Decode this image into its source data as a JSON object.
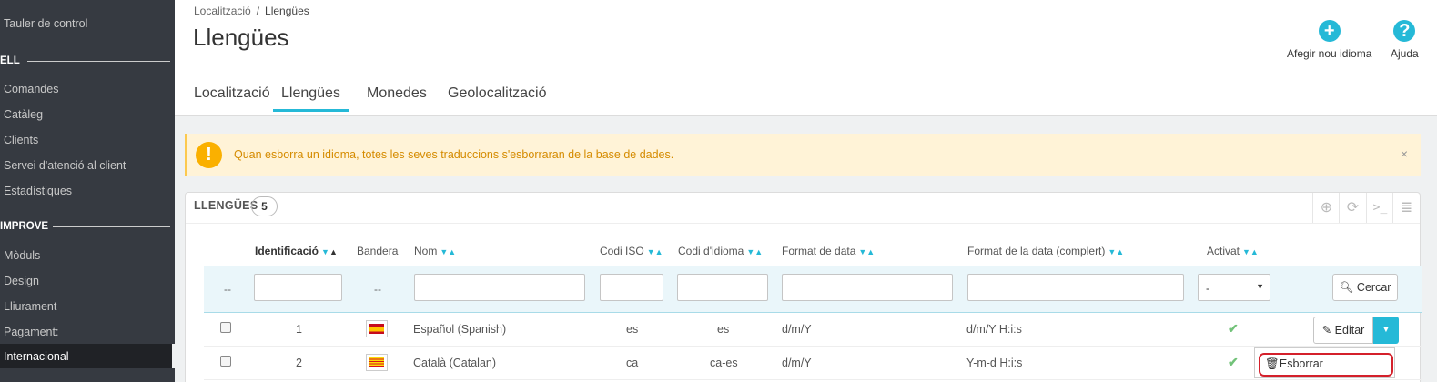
{
  "sidebar": {
    "dashboard": "Tauler de control",
    "section_sell": "ELL",
    "orders": "Comandes",
    "catalog": "Catàleg",
    "customers": "Clients",
    "customer_service": "Servei d'atenció al client",
    "stats": "Estadístiques",
    "section_improve": "IMPROVE",
    "modules": "Mòduls",
    "design": "Design",
    "shipping": "Lliurament",
    "payment": "Pagament:",
    "international": "Internacional"
  },
  "header": {
    "breadcrumb_parent": "Localització",
    "breadcrumb_sep": "/",
    "breadcrumb_current": "Llengües",
    "title": "Llengües",
    "add_button": "Afegir nou idioma",
    "help_button": "Ajuda",
    "tabs": [
      "Localització",
      "Llengües",
      "Monedes",
      "Geolocalització"
    ]
  },
  "alert": {
    "message": "Quan esborra un idioma, totes les seves traduccions s'esborraran de la base de dades.",
    "close": "×"
  },
  "panel": {
    "title": "LLENGÜES",
    "count": "5",
    "columns": [
      "Identificació",
      "Bandera",
      "Nom",
      "Codi ISO",
      "Codi d'idioma",
      "Format de data",
      "Format de la data (complert)",
      "Activat"
    ],
    "filter_dash": "--",
    "filter_active_value": "-",
    "search_button": "Cercar",
    "edit_button": "Editar",
    "delete_action": "Esborrar",
    "rows": [
      {
        "id": "1",
        "name": "Español (Spanish)",
        "iso": "es",
        "lang_code": "es",
        "date_format": "d/m/Y",
        "date_format_full": "d/m/Y H:i:s",
        "active": true,
        "flag": "es"
      },
      {
        "id": "2",
        "name": "Català (Catalan)",
        "iso": "ca",
        "lang_code": "ca-es",
        "date_format": "d/m/Y",
        "date_format_full": "Y-m-d H:i:s",
        "active": true,
        "flag": "ca"
      }
    ]
  },
  "colors": {
    "accent": "#25b9d7",
    "sidebar_bg": "#363a41",
    "warning_bg": "#fff3d7",
    "warning_text": "#d58b00",
    "highlight_red": "#d4202b"
  }
}
